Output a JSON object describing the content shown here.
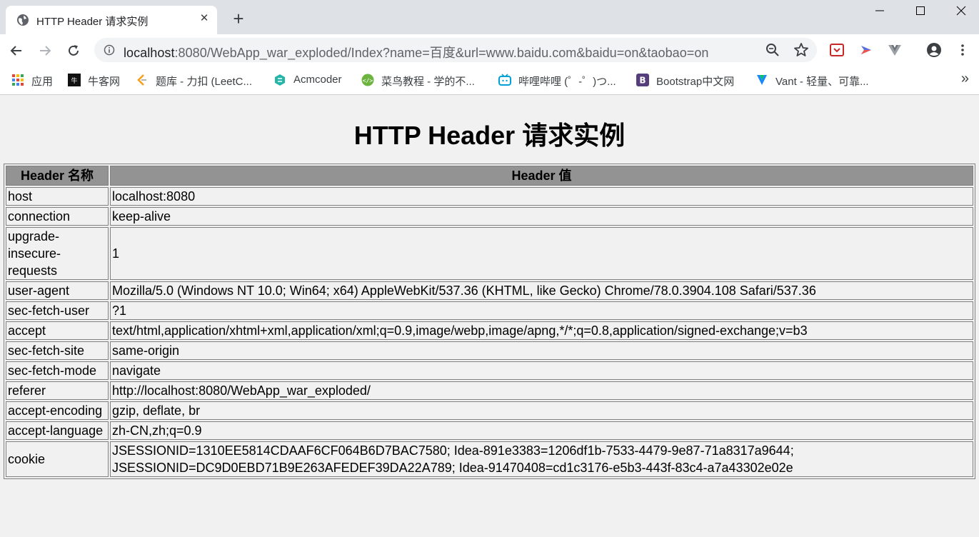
{
  "browser": {
    "tab": {
      "title": "HTTP Header 请求实例",
      "close": "✕",
      "favicon": "globe-icon"
    },
    "new_tab": "+",
    "window_controls": [
      "minimize-icon",
      "maximize-icon",
      "close-icon"
    ],
    "url": {
      "host": "localhost",
      "rest": ":8080/WebApp_war_exploded/Index?name=百度&url=www.baidu.com&baidu=on&taobao=on"
    },
    "bookmarks": [
      {
        "label": "应用",
        "icon": "apps-grid-icon",
        "color": "#ea4335"
      },
      {
        "label": "牛客网",
        "icon": "nowcoder-icon",
        "color": "#111111"
      },
      {
        "label": "题库 - 力扣 (LeetC...",
        "icon": "leetcode-icon",
        "color": "#f89f1b"
      },
      {
        "label": "Acmcoder",
        "icon": "acmcoder-icon",
        "color": "#26b5a8"
      },
      {
        "label": "菜鸟教程 - 学的不...",
        "icon": "runoob-icon",
        "color": "#6cb33f"
      },
      {
        "label": "哔哩哔哩 (゜-゜)つ...",
        "icon": "bilibili-icon",
        "color": "#00a1d6"
      },
      {
        "label": "Bootstrap中文网",
        "icon": "bootstrap-icon",
        "color": "#563d7c"
      },
      {
        "label": "Vant - 轻量、可靠...",
        "icon": "vant-icon",
        "color": "#1989fa"
      }
    ],
    "more": "»"
  },
  "page": {
    "title": "HTTP Header 请求实例",
    "columns": [
      "Header 名称",
      "Header 值"
    ],
    "rows": [
      {
        "name": "host",
        "value": "localhost:8080"
      },
      {
        "name": "connection",
        "value": "keep-alive"
      },
      {
        "name": "upgrade-insecure-requests",
        "value": "1"
      },
      {
        "name": "user-agent",
        "value": "Mozilla/5.0 (Windows NT 10.0; Win64; x64) AppleWebKit/537.36 (KHTML, like Gecko) Chrome/78.0.3904.108 Safari/537.36"
      },
      {
        "name": "sec-fetch-user",
        "value": "?1"
      },
      {
        "name": "accept",
        "value": "text/html,application/xhtml+xml,application/xml;q=0.9,image/webp,image/apng,*/*;q=0.8,application/signed-exchange;v=b3"
      },
      {
        "name": "sec-fetch-site",
        "value": "same-origin"
      },
      {
        "name": "sec-fetch-mode",
        "value": "navigate"
      },
      {
        "name": "referer",
        "value": "http://localhost:8080/WebApp_war_exploded/"
      },
      {
        "name": "accept-encoding",
        "value": "gzip, deflate, br"
      },
      {
        "name": "accept-language",
        "value": "zh-CN,zh;q=0.9"
      },
      {
        "name": "cookie",
        "value": "JSESSIONID=1310EE5814CDAAF6CF064B6D7BAC7580; Idea-891e3383=1206df1b-7533-4479-9e87-71a8317a9644; JSESSIONID=DC9D0EBD71B9E263AFEDEF39DA22A789; Idea-91470408=cd1c3176-e5b3-443f-83c4-a7a43302e02e"
      }
    ]
  }
}
